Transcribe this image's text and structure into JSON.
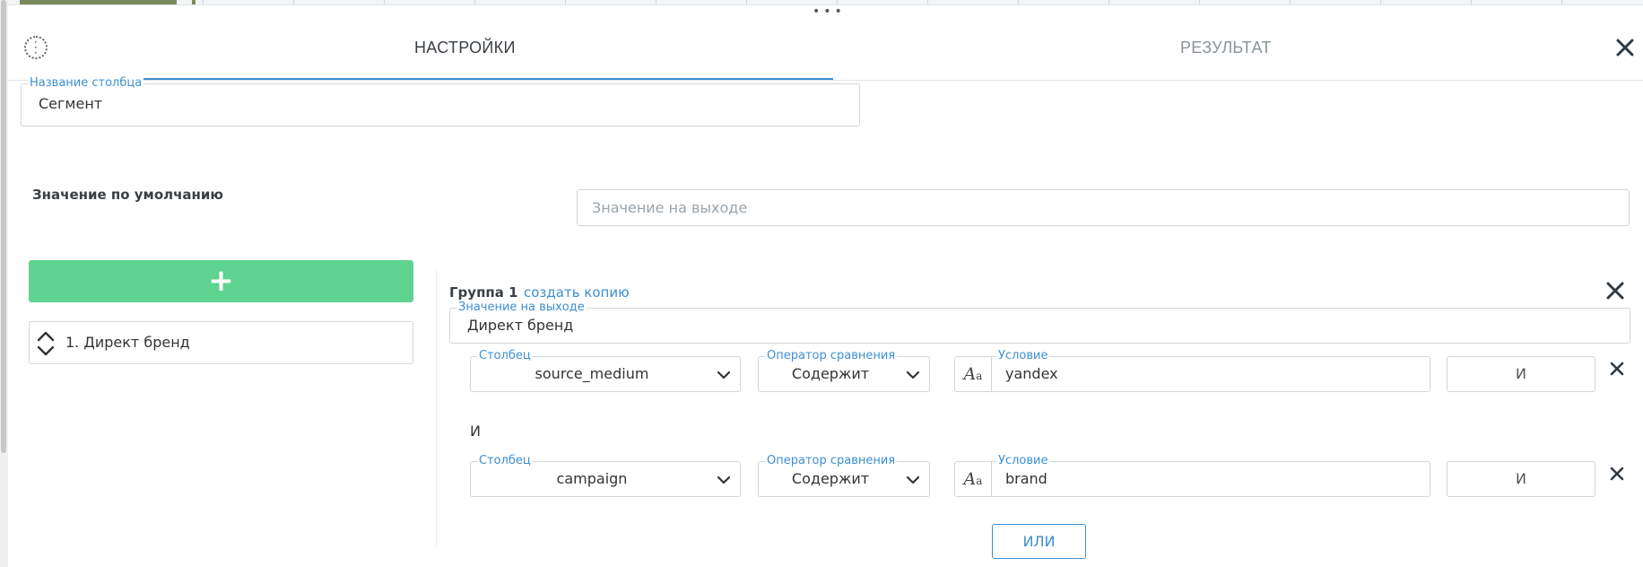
{
  "tabs": {
    "settings": "НАСТРОЙКИ",
    "result": "РЕЗУЛЬТАТ"
  },
  "column_name": {
    "label": "Название столбца",
    "value": "Сегмент"
  },
  "default_value": {
    "label": "Значение по умолчанию",
    "placeholder": "Значение на выходе"
  },
  "add_button": {
    "label": "+"
  },
  "groups": [
    {
      "label": "1. Директ бренд"
    }
  ],
  "group": {
    "title": "Группа 1",
    "copy_link": "создать копию",
    "output": {
      "label": "Значение на выходе",
      "value": "Директ бренд"
    },
    "conditions": [
      {
        "column_label": "Столбец",
        "column": "source_medium",
        "operator_label": "Оператор сравнения",
        "operator": "Содержит",
        "condition_label": "Условие",
        "condition": "yandex",
        "logic": "И"
      },
      {
        "column_label": "Столбец",
        "column": "campaign",
        "operator_label": "Оператор сравнения",
        "operator": "Содержит",
        "condition_label": "Условие",
        "condition": "brand",
        "logic": "И"
      }
    ],
    "between_text": "И",
    "or_button": "ИЛИ"
  },
  "icons": {
    "settings": "settings-dots-icon",
    "close": "close-icon",
    "sort": "sort-arrows-icon",
    "chevron": "chevron-down-icon",
    "case": "case-sensitive-icon",
    "remove": "remove-icon"
  },
  "colors": {
    "accent": "#3d8fd1",
    "add_button": "#5fd390",
    "text": "#333333"
  }
}
